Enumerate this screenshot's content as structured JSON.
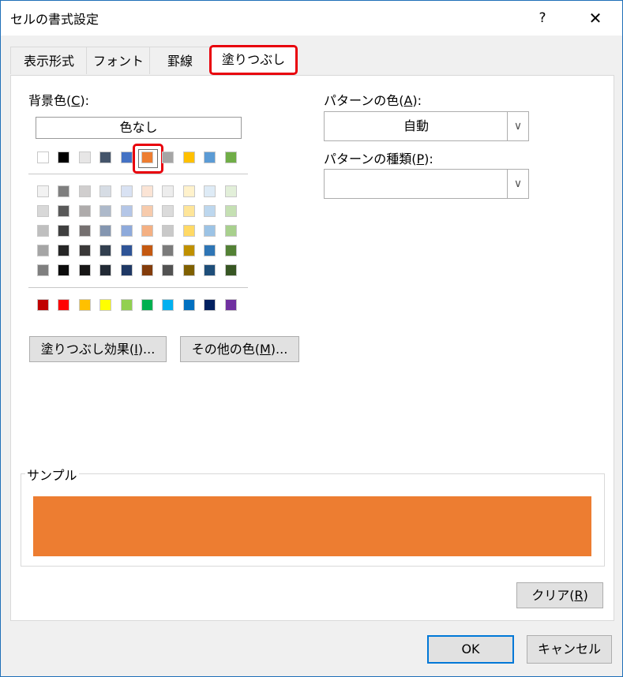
{
  "window": {
    "title": "セルの書式設定",
    "help": "?",
    "close": "✕"
  },
  "tabs": [
    {
      "label": "表示形式"
    },
    {
      "label": "フォント"
    },
    {
      "label": "罫線"
    },
    {
      "label": "塗りつぶし"
    }
  ],
  "background": {
    "label": "背景色(",
    "key": "C",
    "suffix": "):",
    "no_color": "色なし"
  },
  "palette": {
    "top_row": [
      "#ffffff",
      "#000000",
      "#e7e6e6",
      "#44546a",
      "#4472c4",
      "#ed7d31",
      "#a5a5a5",
      "#ffc000",
      "#5b9bd5",
      "#70ad47"
    ],
    "tints": [
      [
        "#f2f2f2",
        "#7f7f7f",
        "#d0cece",
        "#d6dce4",
        "#d9e2f3",
        "#fbe4d5",
        "#ededed",
        "#fff2cc",
        "#deebf6",
        "#e2efd9"
      ],
      [
        "#d8d8d8",
        "#595959",
        "#aeabab",
        "#adb9ca",
        "#b4c6e7",
        "#f7cbac",
        "#dbdbdb",
        "#fee599",
        "#bdd7ee",
        "#c5e0b3"
      ],
      [
        "#bfbfbf",
        "#3f3f3f",
        "#757070",
        "#8496b0",
        "#8eaadb",
        "#f4b083",
        "#c9c9c9",
        "#ffd965",
        "#9cc3e5",
        "#a8d08d"
      ],
      [
        "#a5a5a5",
        "#262626",
        "#3a3838",
        "#323f4f",
        "#2f5496",
        "#c45911",
        "#7b7b7b",
        "#bf9000",
        "#2e75b5",
        "#538135"
      ],
      [
        "#7f7f7f",
        "#0c0c0c",
        "#171616",
        "#222a35",
        "#1f3864",
        "#833c0b",
        "#525252",
        "#7f6000",
        "#1e4e79",
        "#375623"
      ]
    ],
    "standard": [
      "#c00000",
      "#ff0000",
      "#ffc000",
      "#ffff00",
      "#92d050",
      "#00b050",
      "#00b0f0",
      "#0070c0",
      "#002060",
      "#7030a0"
    ],
    "selected_color": "#ed7d31"
  },
  "buttons": {
    "fill_effects": {
      "prefix": "塗りつぶし効果(",
      "key": "I",
      "suffix": ")..."
    },
    "more_colors": {
      "prefix": "その他の色(",
      "key": "M",
      "suffix": ")..."
    },
    "clear": {
      "prefix": "クリア(",
      "key": "R",
      "suffix": ")"
    },
    "ok": "OK",
    "cancel": "キャンセル"
  },
  "pattern_color": {
    "label": "パターンの色(",
    "key": "A",
    "suffix": "):",
    "value": "自動"
  },
  "pattern_style": {
    "label": "パターンの種類(",
    "key": "P",
    "suffix": "):",
    "value": ""
  },
  "sample": {
    "label": "サンプル",
    "color": "#ed7d31"
  }
}
